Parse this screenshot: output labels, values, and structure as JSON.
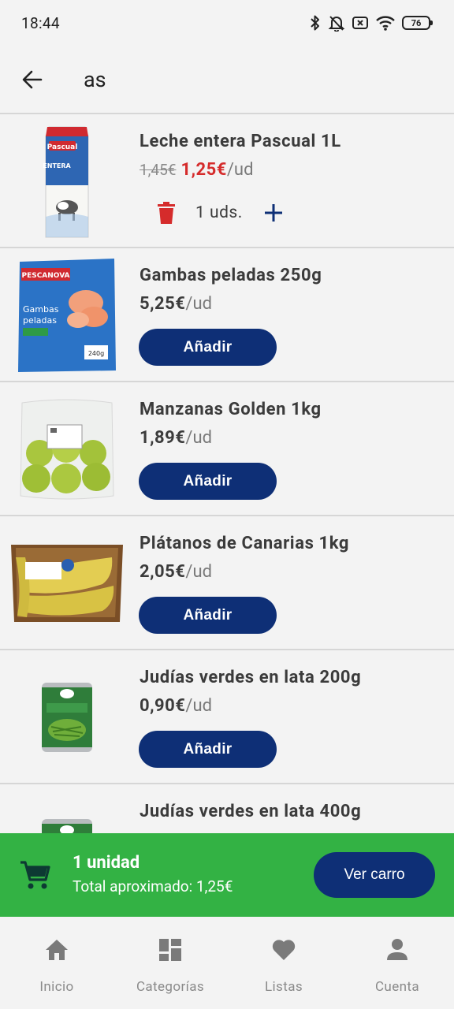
{
  "status_bar": {
    "time": "18:44",
    "battery": "76",
    "icons": [
      "bluetooth-icon",
      "bell-off-icon",
      "sim-off-icon",
      "wifi-icon",
      "battery-icon"
    ]
  },
  "search": {
    "query": "as",
    "back_icon": "arrow-left-icon"
  },
  "products": [
    {
      "name": "Leche entera Pascual 1L",
      "old_price": "1,45€",
      "price": "1,25€",
      "unit": "/ud",
      "in_cart": true,
      "quantity_label": "1 uds.",
      "image": "milk-carton"
    },
    {
      "name": "Gambas peladas 250g",
      "price": "5,25€",
      "unit": "/ud",
      "button_label": "Añadir",
      "image": "shrimp-bag"
    },
    {
      "name": "Manzanas Golden 1kg",
      "price": "1,89€",
      "unit": "/ud",
      "button_label": "Añadir",
      "image": "apple-bag"
    },
    {
      "name": "Plátanos de Canarias 1kg",
      "price": "2,05€",
      "unit": "/ud",
      "button_label": "Añadir",
      "image": "banana-tray"
    },
    {
      "name": "Judías verdes en lata 200g",
      "price": "0,90€",
      "unit": "/ud",
      "button_label": "Añadir",
      "image": "green-bean-can"
    },
    {
      "name": "Judías verdes en lata 400g",
      "image": "green-bean-can"
    }
  ],
  "cart_bar": {
    "count_label": "1 unidad",
    "total_label": "Total aproximado: 1,25€",
    "button_label": "Ver carro"
  },
  "nav": [
    {
      "label": "Inicio",
      "icon": "home-icon"
    },
    {
      "label": "Categorías",
      "icon": "categories-icon"
    },
    {
      "label": "Listas",
      "icon": "heart-icon"
    },
    {
      "label": "Cuenta",
      "icon": "account-icon"
    }
  ],
  "colors": {
    "brand_navy": "#0e2f76",
    "cart_green": "#33b244",
    "sale_red": "#d52b2b",
    "background": "#f3f3f3"
  }
}
